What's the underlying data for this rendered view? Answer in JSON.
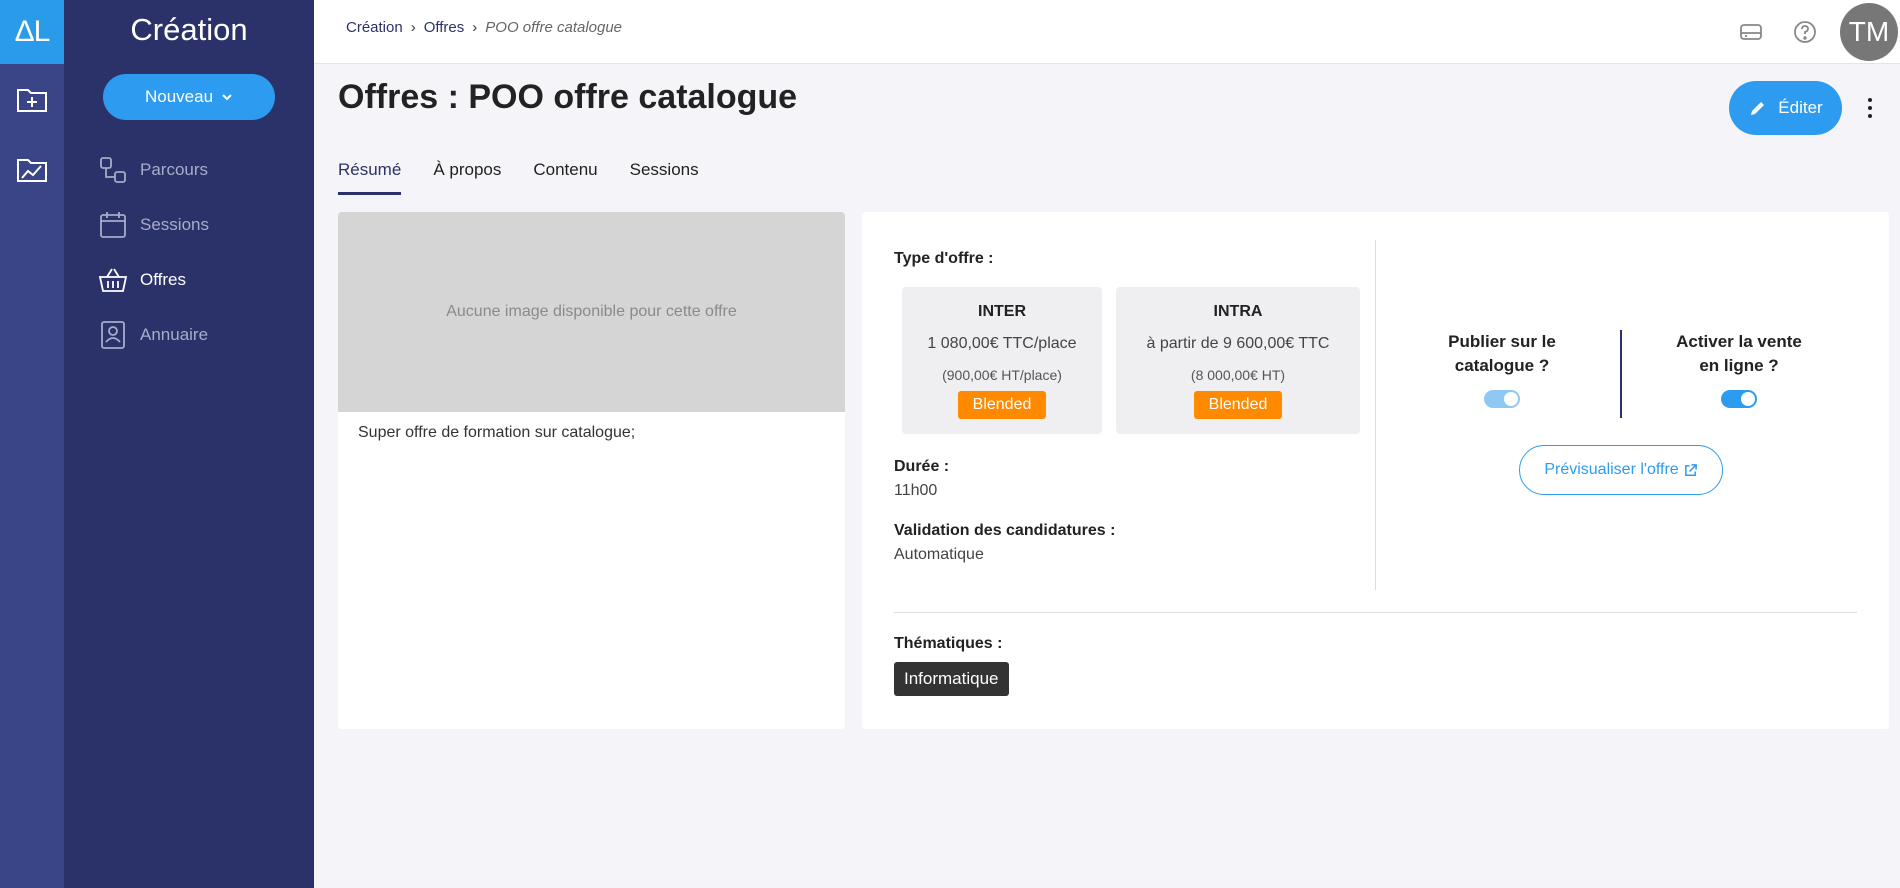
{
  "rail": {
    "logo": "ΔL",
    "items": [
      {
        "icon": "folder-plus-icon"
      },
      {
        "icon": "chart-folder-icon"
      }
    ]
  },
  "sidebar": {
    "title": "Création",
    "new_button": "Nouveau",
    "items": [
      {
        "label": "Parcours",
        "icon": "flow-icon",
        "active": false
      },
      {
        "label": "Sessions",
        "icon": "calendar-icon",
        "active": false
      },
      {
        "label": "Offres",
        "icon": "basket-icon",
        "active": true
      },
      {
        "label": "Annuaire",
        "icon": "contact-book-icon",
        "active": false
      }
    ]
  },
  "topbar": {
    "breadcrumb": [
      "Création",
      "Offres",
      "POO offre catalogue"
    ],
    "avatar": "TM"
  },
  "page": {
    "title": "Offres : POO offre catalogue",
    "edit_button": "Éditer",
    "tabs": [
      "Résumé",
      "À propos",
      "Contenu",
      "Sessions"
    ],
    "active_tab": "Résumé"
  },
  "image_card": {
    "placeholder": "Aucune image disponible pour cette offre",
    "description": "Super offre de formation sur catalogue;"
  },
  "info": {
    "type_label": "Type d'offre :",
    "inter": {
      "name": "INTER",
      "price": "1 080,00€ TTC/place",
      "sub": "(900,00€ HT/place)",
      "badge": "Blended"
    },
    "intra": {
      "name": "INTRA",
      "price": "à partir de 9 600,00€ TTC",
      "sub": "(8 000,00€ HT)",
      "badge": "Blended"
    },
    "duree_label": "Durée :",
    "duree_value": "11h00",
    "validation_label": "Validation des candidatures :",
    "validation_value": "Automatique",
    "themes_label": "Thématiques :",
    "theme": "Informatique",
    "publish_label_1": "Publier sur le",
    "publish_label_2": "catalogue ?",
    "vente_label_1": "Activer la vente",
    "vente_label_2": "en ligne ?",
    "preview_button": "Prévisualiser l'offre"
  },
  "colors": {
    "rail": "#3a4588",
    "sidebar": "#2b3269",
    "accent": "#2d9cf0",
    "badge": "#ff8a00"
  }
}
